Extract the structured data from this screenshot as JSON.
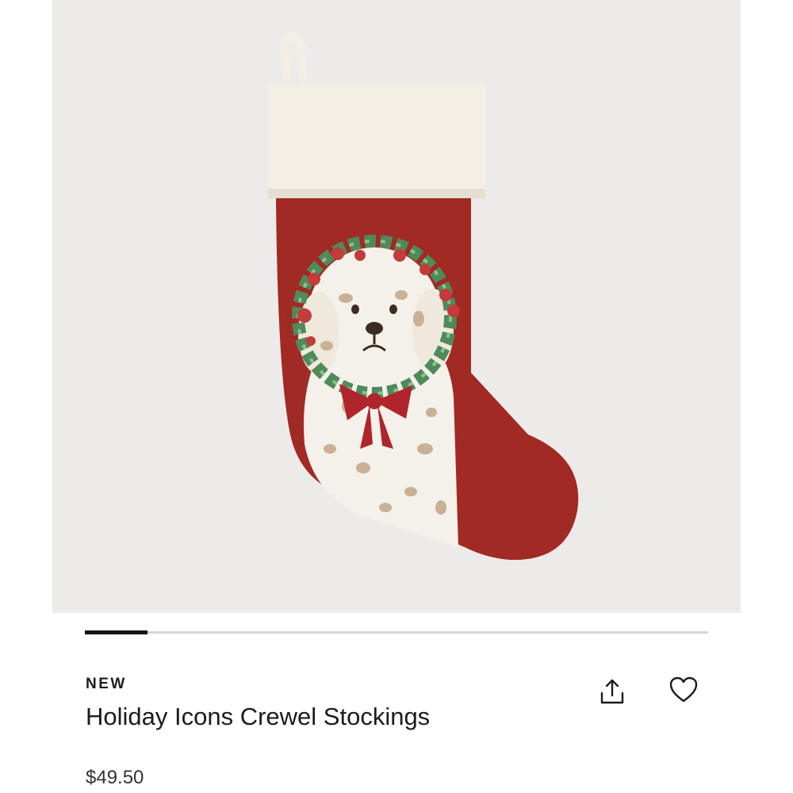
{
  "product": {
    "badge": "NEW",
    "title": "Holiday Icons Crewel Stockings",
    "price": "$49.50",
    "image_alt": "Red crewel stocking with cream cuff featuring a spotted dog wearing a holly wreath and red bow"
  },
  "carousel": {
    "progress": 0.1
  },
  "actions": {
    "share_icon": "share-icon",
    "favorite_icon": "heart-icon"
  },
  "colors": {
    "stocking_red": "#a12a24",
    "cuff_cream": "#f3efe4",
    "background": "#ecebe9",
    "text": "#1c1c1c"
  }
}
